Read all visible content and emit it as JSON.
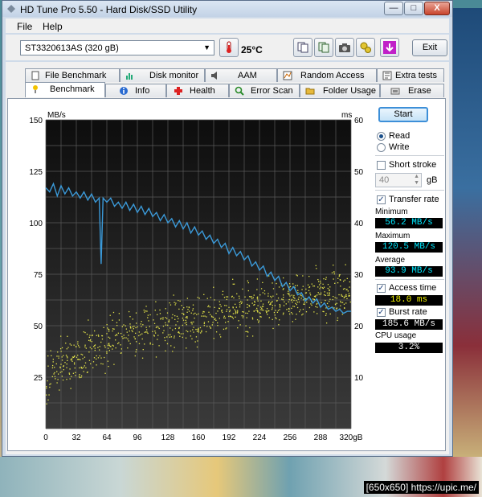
{
  "window": {
    "title": "HD Tune Pro 5.50 - Hard Disk/SSD Utility",
    "controls": {
      "minimize": "—",
      "maximize": "□",
      "close": "X"
    }
  },
  "menu": {
    "file": "File",
    "help": "Help"
  },
  "toolbar": {
    "drive": "ST3320613AS (320 gB)",
    "temperature": "25°C",
    "exit_label": "Exit"
  },
  "tabs_row1": [
    {
      "label": "File Benchmark",
      "icon": "file-benchmark-icon"
    },
    {
      "label": "Disk monitor",
      "icon": "disk-monitor-icon"
    },
    {
      "label": "AAM",
      "icon": "speaker-icon"
    },
    {
      "label": "Random Access",
      "icon": "random-access-icon"
    },
    {
      "label": "Extra tests",
      "icon": "extra-tests-icon"
    }
  ],
  "tabs_row2": [
    {
      "label": "Benchmark",
      "icon": "benchmark-icon",
      "active": true
    },
    {
      "label": "Info",
      "icon": "info-icon"
    },
    {
      "label": "Health",
      "icon": "health-icon"
    },
    {
      "label": "Error Scan",
      "icon": "error-scan-icon"
    },
    {
      "label": "Folder Usage",
      "icon": "folder-icon"
    },
    {
      "label": "Erase",
      "icon": "erase-icon"
    }
  ],
  "side": {
    "start_label": "Start",
    "read_label": "Read",
    "write_label": "Write",
    "mode": "read",
    "short_stroke_label": "Short stroke",
    "short_stroke_checked": false,
    "short_stroke_value": "40",
    "short_stroke_unit": "gB",
    "transfer_rate_label": "Transfer rate",
    "transfer_rate_checked": true,
    "minimum_label": "Minimum",
    "minimum_value": "56.2 MB/s",
    "maximum_label": "Maximum",
    "maximum_value": "120.5 MB/s",
    "average_label": "Average",
    "average_value": "93.9 MB/s",
    "access_time_label": "Access time",
    "access_time_checked": true,
    "access_time_value": "18.0 ms",
    "burst_rate_label": "Burst rate",
    "burst_rate_checked": true,
    "burst_rate_value": "185.6 MB/s",
    "cpu_usage_label": "CPU usage",
    "cpu_usage_value": "3.2%"
  },
  "watermark": "[650x650] https://upic.me/",
  "colors": {
    "plot_bg": "#1a1a1a",
    "grid": "#5a5a5a",
    "transfer_line": "#3b9ad9",
    "access_dots": "#e5e54a"
  },
  "chart_data": {
    "type": "line",
    "y_left_label": "MB/s",
    "y_right_label": "ms",
    "x_unit": "gB",
    "x_ticks": [
      "0",
      "32",
      "64",
      "96",
      "128",
      "160",
      "192",
      "224",
      "256",
      "288",
      "320gB"
    ],
    "y_left_ticks": [
      "150",
      "125",
      "100",
      "75",
      "50",
      "25"
    ],
    "y_right_ticks": [
      "60",
      "50",
      "40",
      "30",
      "20",
      "10"
    ],
    "xlim": [
      0,
      320
    ],
    "ylim_left": [
      0,
      150
    ],
    "ylim_right": [
      0,
      60
    ],
    "grid": true,
    "series": [
      {
        "kind": "line",
        "axis": "left",
        "x": [
          0,
          4,
          8,
          12,
          16,
          20,
          24,
          28,
          32,
          36,
          40,
          44,
          48,
          52,
          56,
          58,
          60,
          64,
          68,
          72,
          76,
          80,
          84,
          88,
          92,
          96,
          100,
          104,
          108,
          112,
          116,
          120,
          124,
          128,
          132,
          136,
          140,
          144,
          148,
          152,
          156,
          160,
          164,
          168,
          172,
          176,
          180,
          184,
          188,
          192,
          196,
          200,
          204,
          208,
          212,
          216,
          220,
          224,
          228,
          232,
          236,
          240,
          244,
          248,
          252,
          256,
          260,
          264,
          268,
          272,
          276,
          280,
          284,
          288,
          292,
          296,
          300,
          304,
          308,
          312,
          316,
          320
        ],
        "values": [
          117,
          115,
          119,
          113,
          118,
          114,
          117,
          113,
          115,
          112,
          115,
          111,
          114,
          110,
          112,
          80,
          112,
          110,
          112,
          108,
          110,
          107,
          110,
          106,
          109,
          105,
          108,
          104,
          107,
          103,
          105,
          101,
          104,
          100,
          102,
          98,
          101,
          97,
          100,
          95,
          98,
          94,
          96,
          92,
          94,
          90,
          92,
          88,
          90,
          85,
          88,
          84,
          86,
          82,
          84,
          79,
          81,
          77,
          79,
          74,
          76,
          72,
          74,
          69,
          71,
          67,
          69,
          65,
          66,
          62,
          64,
          61,
          63,
          59,
          61,
          58,
          59,
          57,
          58,
          56,
          57,
          57
        ]
      },
      {
        "kind": "scatter",
        "axis": "right",
        "name": "Access time",
        "trend_start": 8.5,
        "trend_end": 27,
        "spread": 4.5
      }
    ]
  }
}
